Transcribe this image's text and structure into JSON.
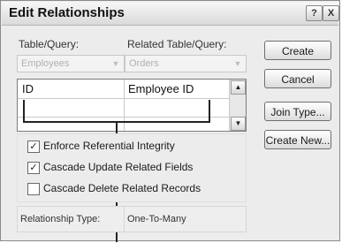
{
  "window": {
    "title": "Edit Relationships",
    "help_glyph": "?",
    "close_glyph": "X"
  },
  "table_query": {
    "label": "Table/Query:",
    "value": "Employees"
  },
  "related_table_query": {
    "label": "Related Table/Query:",
    "value": "Orders"
  },
  "fields_grid": {
    "rows": [
      {
        "left": "ID",
        "right": "Employee ID"
      },
      {
        "left": "",
        "right": ""
      }
    ]
  },
  "options": {
    "enforce_integrity": {
      "label": "Enforce Referential Integrity",
      "checked": true
    },
    "cascade_update": {
      "label": "Cascade Update Related Fields",
      "checked": true
    },
    "cascade_delete": {
      "label": "Cascade Delete Related Records",
      "checked": false
    }
  },
  "relationship_type": {
    "label": "Relationship Type:",
    "value": "One-To-Many"
  },
  "buttons": {
    "create": "Create",
    "cancel": "Cancel",
    "join_type": "Join Type...",
    "create_new": "Create New..."
  },
  "glyphs": {
    "check": "✓",
    "dropdown": "▼",
    "scroll_up": "▲",
    "scroll_down": "▼"
  }
}
